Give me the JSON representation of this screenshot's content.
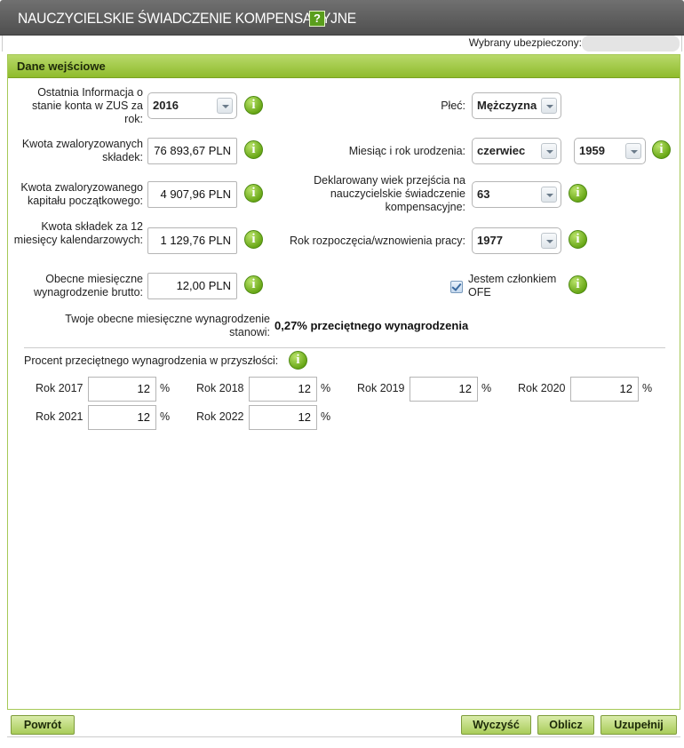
{
  "window": {
    "title": "NAUCZYCIELSKIE ŚWIADCZENIE KOMPENSACYJNE",
    "help_label": "?"
  },
  "insured": {
    "label": "Wybrany ubezpieczony:"
  },
  "panel": {
    "title": "Dane wejściowe"
  },
  "form": {
    "last_info_label": "Ostatnia Informacja o stanie konta w ZUS za rok:",
    "last_info_value": "2016",
    "sex_label": "Płeć:",
    "sex_value": "Mężczyzna",
    "contrib_label": "Kwota zwaloryzowanych składek:",
    "contrib_value": "76 893,67 PLN",
    "birth_label": "Miesiąc i rok urodzenia:",
    "birth_month": "czerwiec",
    "birth_year": "1959",
    "capital_label": "Kwota zwaloryzowanego kapitału początkowego:",
    "capital_value": "4 907,96 PLN",
    "age_label": "Deklarowany wiek przejścia na nauczycielskie świadczenie kompensacyjne:",
    "age_value": "63",
    "last12_label": "Kwota składek za 12 miesięcy kalendarzowych:",
    "last12_value": "1 129,76 PLN",
    "start_label": "Rok rozpoczęcia/wznowienia pracy:",
    "start_value": "1977",
    "salary_label": "Obecne miesięczne wynagrodzenie brutto:",
    "salary_value": "12,00 PLN",
    "ofe_label": "Jestem członkiem OFE",
    "ofe_checked": true,
    "ratio_label": "Twoje obecne miesięczne wynagrodzenie stanowi:",
    "ratio_value": "0,27% przeciętnego wynagrodzenia",
    "future_label": "Procent przeciętnego wynagrodzenia w przyszłości:"
  },
  "future": [
    {
      "year": "Rok 2017",
      "value": "12",
      "unit": "%"
    },
    {
      "year": "Rok 2018",
      "value": "12",
      "unit": "%"
    },
    {
      "year": "Rok 2019",
      "value": "12",
      "unit": "%"
    },
    {
      "year": "Rok 2020",
      "value": "12",
      "unit": "%"
    },
    {
      "year": "Rok 2021",
      "value": "12",
      "unit": "%"
    },
    {
      "year": "Rok 2022",
      "value": "12",
      "unit": "%"
    }
  ],
  "buttons": {
    "back": "Powrót",
    "clear": "Wyczyść",
    "calculate": "Oblicz",
    "fill": "Uzupełnij"
  },
  "icons": {
    "info": "i"
  },
  "colors": {
    "accent": "#8fbb2c",
    "title_bar": "#5a5a5a",
    "info_icon": "#6aa818"
  }
}
